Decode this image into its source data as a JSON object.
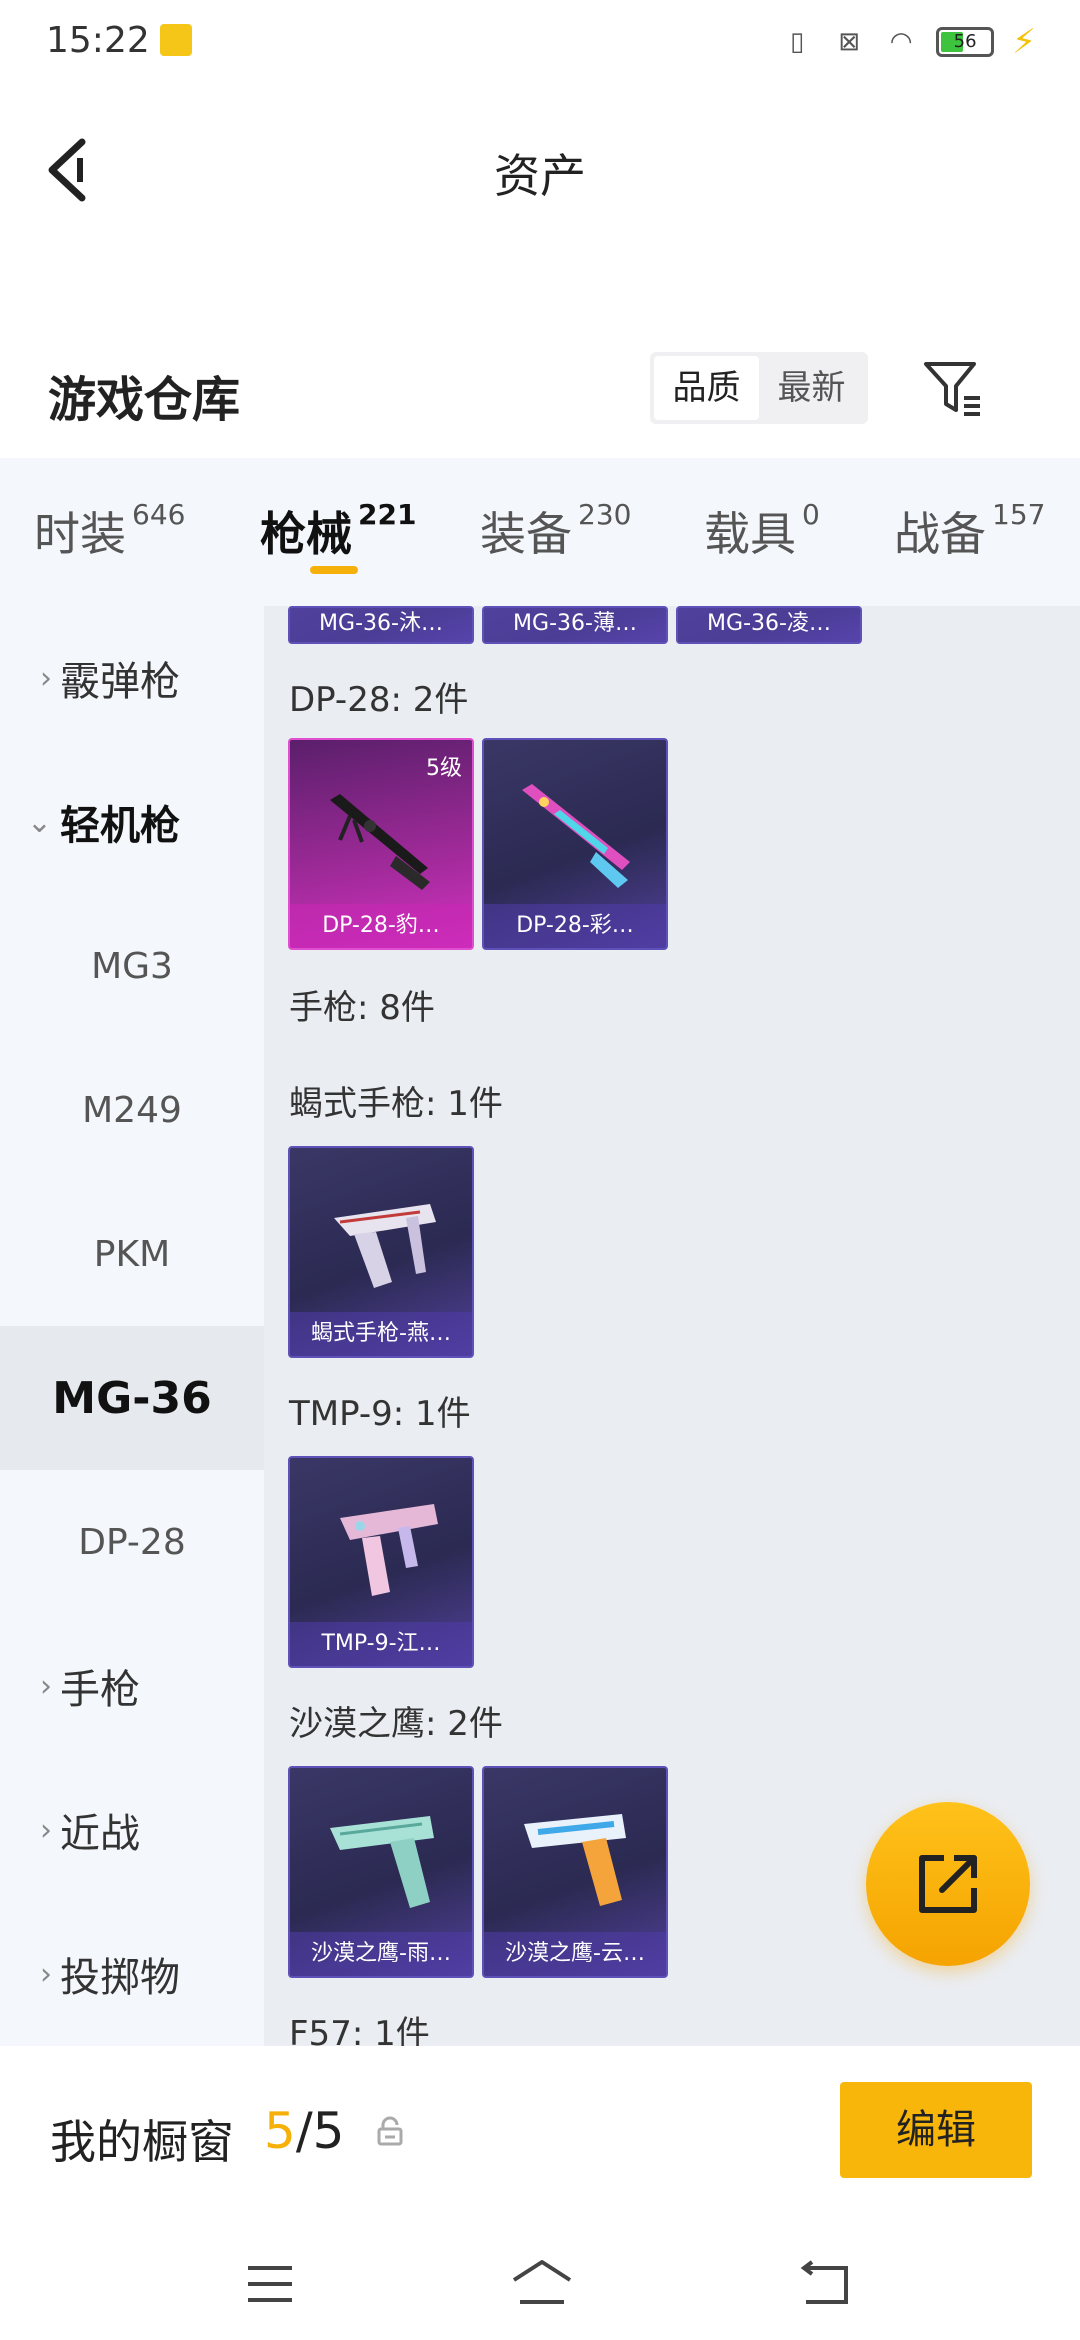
{
  "status_bar": {
    "time": "15:22",
    "battery": "56"
  },
  "header": {
    "title": "资产"
  },
  "section": {
    "title": "游戏仓库",
    "sort_options": [
      "品质",
      "最新"
    ]
  },
  "category_tabs": [
    {
      "label": "时装",
      "count": "646"
    },
    {
      "label": "枪械",
      "count": "221"
    },
    {
      "label": "装备",
      "count": "230"
    },
    {
      "label": "载具",
      "count": "0"
    },
    {
      "label": "战备",
      "count": "157"
    }
  ],
  "sidebar": {
    "items": [
      {
        "label": "霰弹枪"
      },
      {
        "label": "轻机枪"
      },
      {
        "label": "MG3"
      },
      {
        "label": "M249"
      },
      {
        "label": "PKM"
      },
      {
        "label": "MG-36"
      },
      {
        "label": "DP-28"
      },
      {
        "label": "手枪"
      },
      {
        "label": "近战"
      },
      {
        "label": "投掷物"
      }
    ]
  },
  "content": {
    "top_partial_cards": [
      "MG-36-沐…",
      "MG-36-薄…",
      "MG-36-凌…"
    ],
    "groups": [
      {
        "label": "DP-28: 2件",
        "cards": [
          {
            "name": "DP-28-豹…",
            "level": "5级"
          },
          {
            "name": "DP-28-彩…"
          }
        ]
      },
      {
        "label": "手枪: 8件"
      },
      {
        "label": "蝎式手枪: 1件",
        "cards": [
          {
            "name": "蝎式手枪-燕…"
          }
        ]
      },
      {
        "label": "TMP-9: 1件",
        "cards": [
          {
            "name": "TMP-9-江…"
          }
        ]
      },
      {
        "label": "沙漠之鹰: 2件",
        "cards": [
          {
            "name": "沙漠之鹰-雨…"
          },
          {
            "name": "沙漠之鹰-云…"
          }
        ]
      },
      {
        "label": "F57: 1件"
      }
    ]
  },
  "showcase": {
    "label": "我的橱窗",
    "current": "5",
    "separator": "/",
    "total": "5",
    "edit_label": "编辑"
  },
  "colors": {
    "accent": "#f5b10a",
    "card_purple": "#2b2a52",
    "card_pink": "#d432c2"
  }
}
